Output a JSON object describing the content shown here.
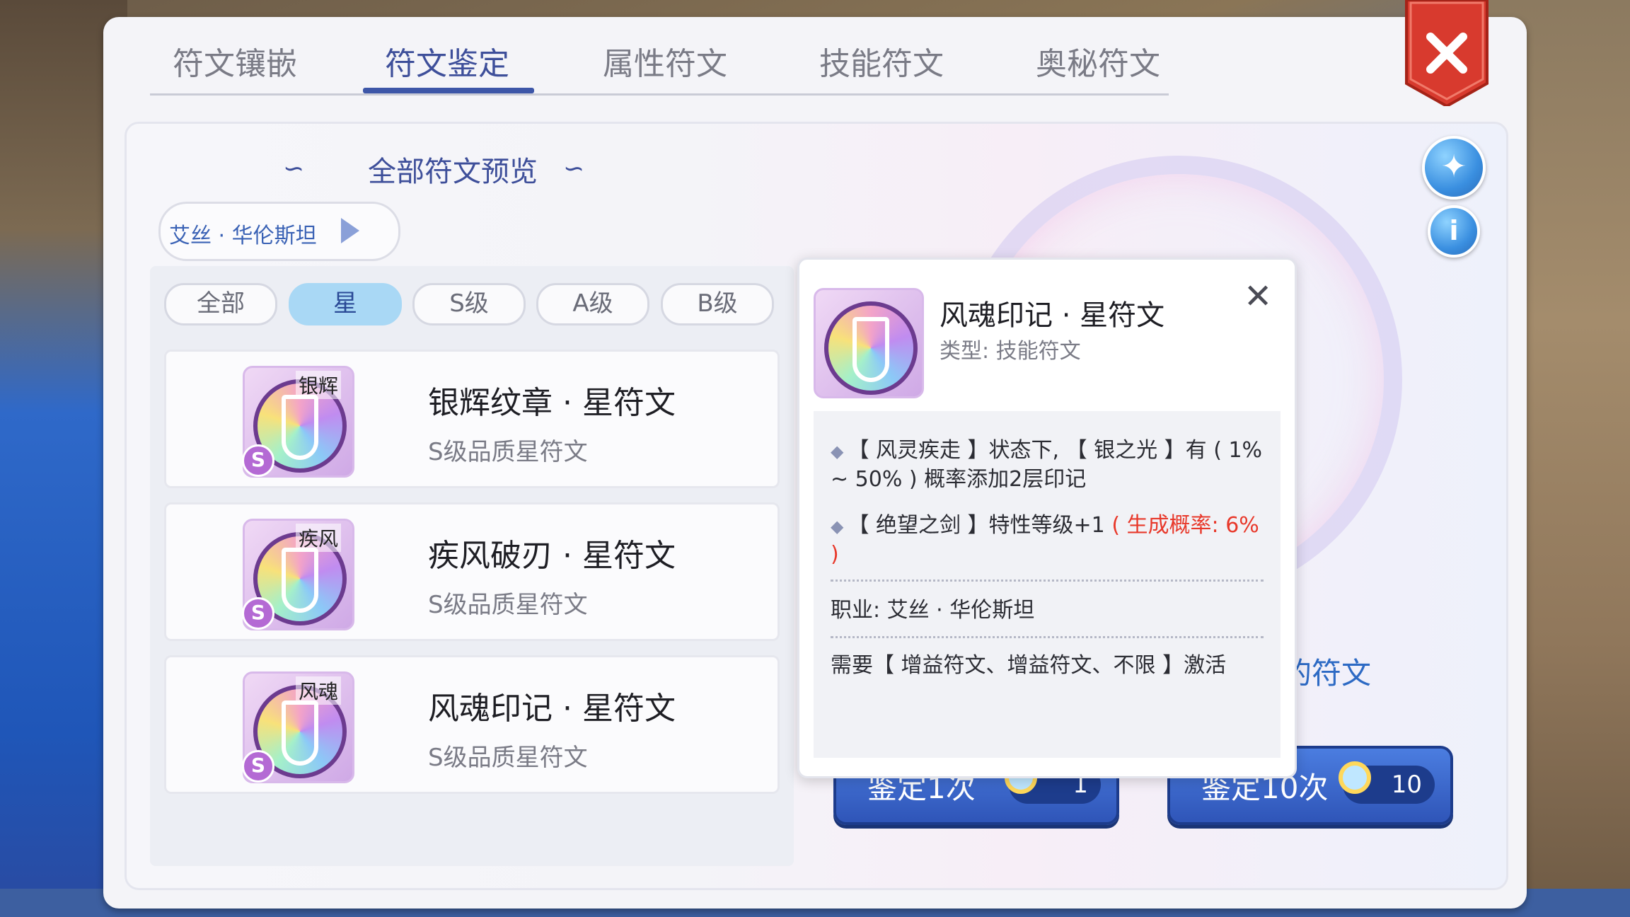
{
  "tabs": [
    {
      "label": "符文镶嵌"
    },
    {
      "label": "符文鉴定"
    },
    {
      "label": "属性符文"
    },
    {
      "label": "技能符文"
    },
    {
      "label": "奥秘符文"
    }
  ],
  "active_tab": "符文鉴定",
  "preview": {
    "title": "全部符文预览",
    "character": "艾丝 · 华伦斯坦"
  },
  "filters": [
    {
      "label": "全部"
    },
    {
      "label": "星"
    },
    {
      "label": "S级"
    },
    {
      "label": "A级"
    },
    {
      "label": "B级"
    }
  ],
  "active_filter": "星",
  "runes": [
    {
      "tag": "银辉",
      "grade_badge": "S",
      "name": "银辉纹章 · 星符文",
      "grade": "S级品质星符文"
    },
    {
      "tag": "疾风",
      "grade_badge": "S",
      "name": "疾风破刃 · 星符文",
      "grade": "S级品质星符文"
    },
    {
      "tag": "风魂",
      "grade_badge": "S",
      "name": "风魂印记 · 星符文",
      "grade": "S级品质星符文"
    }
  ],
  "popup": {
    "title": "风魂印记 · 星符文",
    "type": "类型: 技能符文",
    "effect1": "【 风灵疾走 】状态下, 【 银之光 】有 ( 1% ~ 50% ) 概率添加2层印记",
    "effect2_main": "【 绝望之剑 】特性等级+1 ",
    "effect2_red": "( 生成概率: 6% )",
    "job": "职业: 艾丝 · 华伦斯坦",
    "require": "需要【 增益符文、增益符文、不限 】激活"
  },
  "partial_text": "的符文",
  "buttons": {
    "identify_one": {
      "label": "鉴定1次",
      "count": "1"
    },
    "identify_ten": {
      "label": "鉴定10次",
      "count": "10"
    }
  },
  "colors": {
    "accent": "#3e4f9a",
    "close_red": "#d83a2e",
    "button_blue": "#2f55b8",
    "highlight_red": "#e8382a"
  },
  "icons": [
    "close-icon",
    "magic-wand-icon",
    "info-icon",
    "play-arrow-icon",
    "magnifier-icon"
  ]
}
